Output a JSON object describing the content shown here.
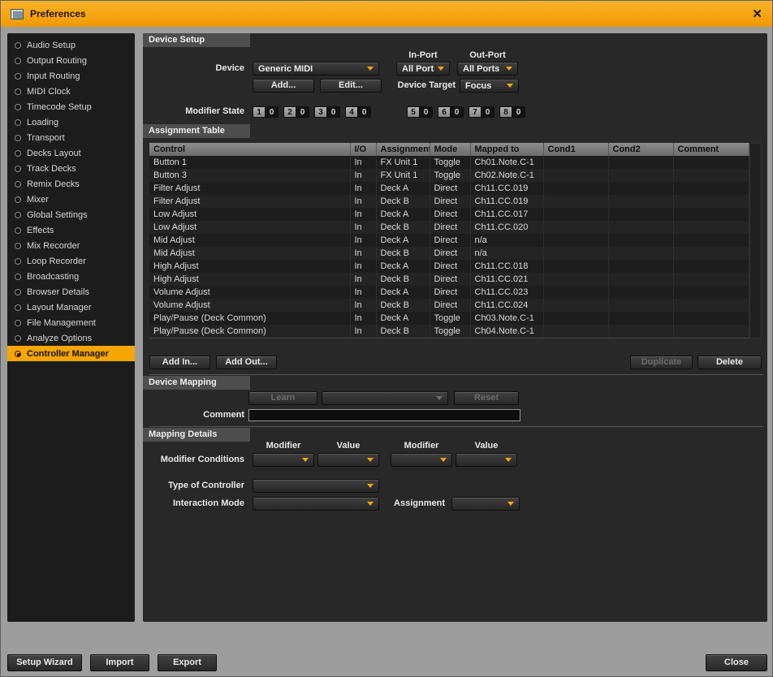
{
  "window": {
    "title": "Preferences",
    "close_glyph": "✕"
  },
  "sidebar": {
    "items": [
      {
        "label": "Audio Setup",
        "selected": false
      },
      {
        "label": "Output Routing",
        "selected": false
      },
      {
        "label": "Input Routing",
        "selected": false
      },
      {
        "label": "MIDI Clock",
        "selected": false
      },
      {
        "label": "Timecode Setup",
        "selected": false
      },
      {
        "label": "Loading",
        "selected": false
      },
      {
        "label": "Transport",
        "selected": false
      },
      {
        "label": "Decks Layout",
        "selected": false
      },
      {
        "label": "Track Decks",
        "selected": false
      },
      {
        "label": "Remix Decks",
        "selected": false
      },
      {
        "label": "Mixer",
        "selected": false
      },
      {
        "label": "Global Settings",
        "selected": false
      },
      {
        "label": "Effects",
        "selected": false
      },
      {
        "label": "Mix Recorder",
        "selected": false
      },
      {
        "label": "Loop Recorder",
        "selected": false
      },
      {
        "label": "Broadcasting",
        "selected": false
      },
      {
        "label": "Browser Details",
        "selected": false
      },
      {
        "label": "Layout Manager",
        "selected": false
      },
      {
        "label": "File Management",
        "selected": false
      },
      {
        "label": "Analyze Options",
        "selected": false
      },
      {
        "label": "Controller Manager",
        "selected": true
      }
    ]
  },
  "device_setup": {
    "header": "Device Setup",
    "device_label": "Device",
    "device_value": "Generic MIDI",
    "in_port_label": "In-Port",
    "in_port_value": "All Ports",
    "out_port_label": "Out-Port",
    "out_port_value": "All Ports",
    "add_button": "Add...",
    "edit_button": "Edit...",
    "device_target_label": "Device Target",
    "device_target_value": "Focus",
    "modifier_state_label": "Modifier State",
    "modifiers": [
      {
        "num": "1",
        "val": "0"
      },
      {
        "num": "2",
        "val": "0"
      },
      {
        "num": "3",
        "val": "0"
      },
      {
        "num": "4",
        "val": "0"
      },
      {
        "num": "5",
        "val": "0"
      },
      {
        "num": "6",
        "val": "0"
      },
      {
        "num": "7",
        "val": "0"
      },
      {
        "num": "8",
        "val": "0"
      }
    ]
  },
  "assignment_table": {
    "header": "Assignment Table",
    "columns": [
      "Control",
      "I/O",
      "Assignment",
      "Mode",
      "Mapped to",
      "Cond1",
      "Cond2",
      "Comment"
    ],
    "rows": [
      [
        "Button 1",
        "In",
        "FX Unit 1",
        "Toggle",
        "Ch01.Note.C-1",
        "",
        "",
        ""
      ],
      [
        "Button 3",
        "In",
        "FX Unit 1",
        "Toggle",
        "Ch02.Note.C-1",
        "",
        "",
        ""
      ],
      [
        "Filter Adjust",
        "In",
        "Deck A",
        "Direct",
        "Ch11.CC.019",
        "",
        "",
        ""
      ],
      [
        "Filter Adjust",
        "In",
        "Deck B",
        "Direct",
        "Ch11.CC.019",
        "",
        "",
        ""
      ],
      [
        "Low Adjust",
        "In",
        "Deck A",
        "Direct",
        "Ch11.CC.017",
        "",
        "",
        ""
      ],
      [
        "Low Adjust",
        "In",
        "Deck B",
        "Direct",
        "Ch11.CC.020",
        "",
        "",
        ""
      ],
      [
        "Mid Adjust",
        "In",
        "Deck A",
        "Direct",
        "n/a",
        "",
        "",
        ""
      ],
      [
        "Mid Adjust",
        "In",
        "Deck B",
        "Direct",
        "n/a",
        "",
        "",
        ""
      ],
      [
        "High Adjust",
        "In",
        "Deck A",
        "Direct",
        "Ch11.CC.018",
        "",
        "",
        ""
      ],
      [
        "High Adjust",
        "In",
        "Deck B",
        "Direct",
        "Ch11.CC.021",
        "",
        "",
        ""
      ],
      [
        "Volume Adjust",
        "In",
        "Deck A",
        "Direct",
        "Ch11.CC.023",
        "",
        "",
        ""
      ],
      [
        "Volume Adjust",
        "In",
        "Deck B",
        "Direct",
        "Ch11.CC.024",
        "",
        "",
        ""
      ],
      [
        "Play/Pause (Deck Common)",
        "In",
        "Deck A",
        "Toggle",
        "Ch03.Note.C-1",
        "",
        "",
        ""
      ],
      [
        "Play/Pause (Deck Common)",
        "In",
        "Deck B",
        "Toggle",
        "Ch04.Note.C-1",
        "",
        "",
        ""
      ]
    ],
    "add_in_button": "Add In...",
    "add_out_button": "Add Out...",
    "duplicate_button": "Duplicate",
    "delete_button": "Delete"
  },
  "device_mapping": {
    "header": "Device Mapping",
    "learn_button": "Learn",
    "reset_button": "Reset",
    "comment_label": "Comment",
    "comment_value": ""
  },
  "mapping_details": {
    "header": "Mapping Details",
    "columns": [
      "Modifier",
      "Value",
      "Modifier",
      "Value"
    ],
    "modifier_conditions_label": "Modifier Conditions",
    "type_of_controller_label": "Type of Controller",
    "interaction_mode_label": "Interaction Mode",
    "assignment_label": "Assignment"
  },
  "footer": {
    "setup_wizard": "Setup Wizard",
    "import": "Import",
    "export": "Export",
    "close": "Close"
  },
  "colors": {
    "accent": "#f7a600",
    "titlebar": "#f5a300",
    "panel": "#282828"
  }
}
